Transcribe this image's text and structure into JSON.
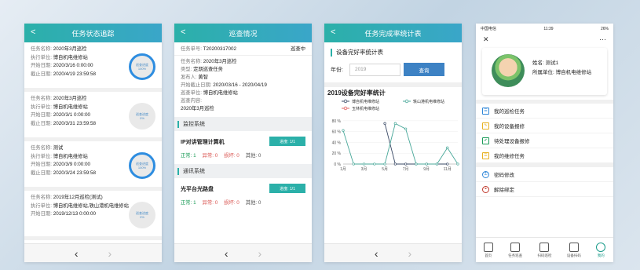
{
  "screen1": {
    "title": "任务状态追踪",
    "labels": {
      "name": "任务名称:",
      "unit": "执行单位:",
      "start": "开始日期:",
      "end": "截止日期:"
    },
    "cards": [
      {
        "name": "2020年3月巡检",
        "unit": "博自机电维修站",
        "start": "2020/3/16 0:00:00",
        "end": "2020/4/19 23:59:58",
        "ring_line1": "巡查进度",
        "ring_line2": "100%"
      },
      {
        "name": "2020年3月巡检",
        "unit": "博自机电维修站",
        "start": "2020/3/1 0:00:00",
        "end": "2020/3/31 23:59:58",
        "ring_line1": "巡查进度",
        "ring_line2": "0%"
      },
      {
        "name": "测试",
        "unit": "博自机电维修站",
        "start": "2020/3/9 0:00:00",
        "end": "2020/3/24 23:59:58",
        "ring_line1": "巡查进度",
        "ring_line2": "100%"
      },
      {
        "name": "2019年12月巡检(测试)",
        "unit": "博自机电维修站,轶山港机电维修站",
        "start": "2019/12/13 0:00:00",
        "ring_line1": "巡查进度",
        "ring_line2": "0%"
      }
    ]
  },
  "screen2": {
    "title": "巡查情况",
    "order_label": "任务单号:",
    "order_no": "T20200317002",
    "status": "巡查中",
    "rows": [
      {
        "k": "任务名称:",
        "v": "2020年3月巡检"
      },
      {
        "k": "类型:",
        "v": "定期巡查任务"
      },
      {
        "k": "发布人:",
        "v": "黄智"
      },
      {
        "k": "开始截止日期:",
        "v": "2020/03/16 - 2020/04/19"
      },
      {
        "k": "巡查单位:",
        "v": "博自机电维修站"
      }
    ],
    "content_label": "巡查内容:",
    "content_value": "2020年3月巡检",
    "sections": [
      {
        "title": "监控系统",
        "device": "IP对讲管理计算机",
        "progress": "进度: 1/1",
        "normal": "正常: 1",
        "abnormal": "异常: 0",
        "damaged": "损坏: 0",
        "other": "其他: 0"
      },
      {
        "title": "通讯系统",
        "device": "光平台光路盘",
        "progress": "进度: 1/1",
        "normal": "正常: 1",
        "abnormal": "异常: 0",
        "damaged": "损坏: 0",
        "other": "其他: 0"
      }
    ]
  },
  "screen3": {
    "title": "任务完成率统计表",
    "subtitle": "设备完好率统计表",
    "year_label": "年份:",
    "year_value": "2019",
    "query_label": "查询"
  },
  "chart_data": {
    "type": "line",
    "title": "2019设备完好率统计",
    "x": [
      1,
      2,
      3,
      4,
      5,
      6,
      7,
      8,
      9,
      10,
      11,
      12
    ],
    "xticks": [
      "1月",
      "3月",
      "5月",
      "7月",
      "9月",
      "11月"
    ],
    "yticks": [
      "0 %",
      "20 %",
      "40 %",
      "60 %",
      "80 %"
    ],
    "ylim": [
      0,
      90
    ],
    "legend_position": "top",
    "series": [
      {
        "name": "博自机电维修站",
        "color": "#3a4a66",
        "values": [
          null,
          null,
          null,
          null,
          75,
          0,
          0,
          0,
          0,
          0,
          0,
          null
        ]
      },
      {
        "name": "轶山港机电维修站",
        "color": "#4aa89a",
        "values": [
          62,
          0,
          0,
          0,
          0,
          75,
          65,
          0,
          0,
          0,
          30,
          0
        ]
      },
      {
        "name": "玉林机电维修站",
        "color": "#e06060",
        "values": [
          null,
          null,
          null,
          null,
          null,
          null,
          null,
          null,
          null,
          null,
          null,
          null
        ]
      }
    ]
  },
  "screen4": {
    "status_left": "中国电信",
    "status_time": "11:39",
    "status_right": "26%",
    "close_icon": "✕",
    "more_icon": "···",
    "name_label": "姓名: 测试1",
    "unit_label": "所属单位: 博自机电维修站",
    "menu": [
      "我的巡检任务",
      "我的设备报修",
      "待处理设备报修",
      "我的维修任务"
    ],
    "menu2": [
      "密码修改",
      "解除绑定"
    ],
    "tabs": [
      "首页",
      "任务巡查",
      "扫码巡检",
      "设备扫码",
      "我的"
    ]
  },
  "nav": {
    "back": "‹",
    "forward": "›"
  }
}
